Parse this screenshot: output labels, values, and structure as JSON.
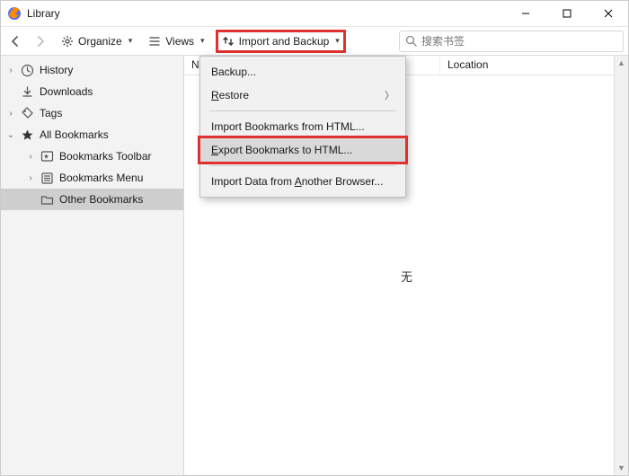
{
  "window": {
    "title": "Library"
  },
  "toolbar": {
    "organize_label": "Organize",
    "views_label": "Views",
    "import_backup_label": "Import and Backup"
  },
  "search": {
    "placeholder": "搜索书签"
  },
  "sidebar": {
    "items": [
      {
        "label": "History"
      },
      {
        "label": "Downloads"
      },
      {
        "label": "Tags"
      },
      {
        "label": "All Bookmarks"
      },
      {
        "label": "Bookmarks Toolbar"
      },
      {
        "label": "Bookmarks Menu"
      },
      {
        "label": "Other Bookmarks"
      }
    ]
  },
  "columns": {
    "name": "Name",
    "location": "Location"
  },
  "empty_text": "无",
  "menu": {
    "backup": "Backup...",
    "restore": "Restore",
    "import_html": "Import Bookmarks from HTML...",
    "export_html": "Export Bookmarks to HTML...",
    "import_browser": "Import Data from Another Browser..."
  }
}
